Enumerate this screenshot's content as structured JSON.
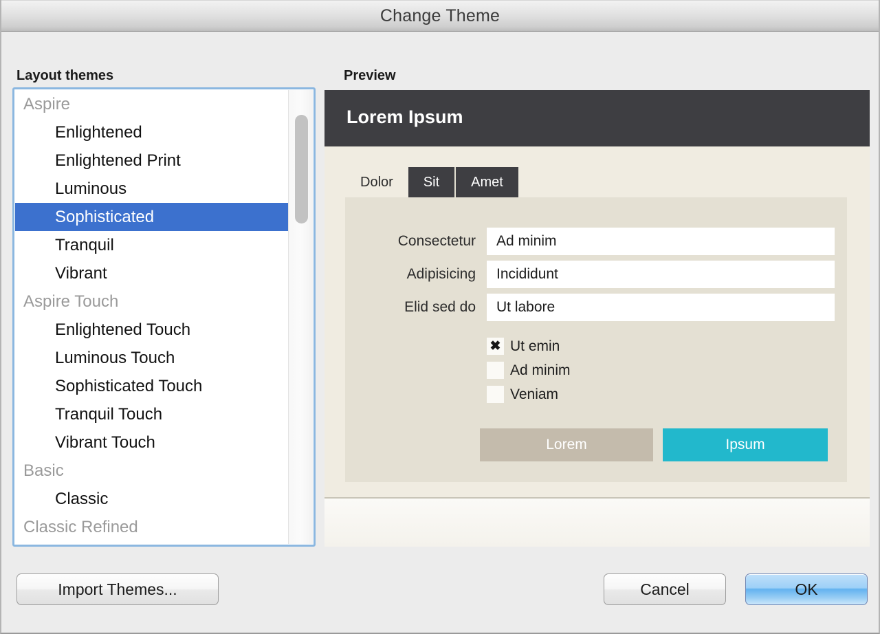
{
  "window": {
    "title": "Change Theme"
  },
  "left": {
    "heading": "Layout themes",
    "list": [
      {
        "label": "Aspire",
        "type": "group",
        "selected": false
      },
      {
        "label": "Enlightened",
        "type": "item",
        "selected": false
      },
      {
        "label": "Enlightened Print",
        "type": "item",
        "selected": false
      },
      {
        "label": "Luminous",
        "type": "item",
        "selected": false
      },
      {
        "label": "Sophisticated",
        "type": "item",
        "selected": true
      },
      {
        "label": "Tranquil",
        "type": "item",
        "selected": false
      },
      {
        "label": "Vibrant",
        "type": "item",
        "selected": false
      },
      {
        "label": "Aspire Touch",
        "type": "group",
        "selected": false
      },
      {
        "label": "Enlightened Touch",
        "type": "item",
        "selected": false
      },
      {
        "label": "Luminous Touch",
        "type": "item",
        "selected": false
      },
      {
        "label": "Sophisticated Touch",
        "type": "item",
        "selected": false
      },
      {
        "label": "Tranquil Touch",
        "type": "item",
        "selected": false
      },
      {
        "label": "Vibrant Touch",
        "type": "item",
        "selected": false
      },
      {
        "label": "Basic",
        "type": "group",
        "selected": false
      },
      {
        "label": "Classic",
        "type": "item",
        "selected": false
      },
      {
        "label": "Classic Refined",
        "type": "group",
        "selected": false
      }
    ]
  },
  "preview": {
    "heading": "Preview",
    "header_title": "Lorem Ipsum",
    "tabs": [
      {
        "label": "Dolor",
        "active": true
      },
      {
        "label": "Sit",
        "active": false
      },
      {
        "label": "Amet",
        "active": false
      }
    ],
    "fields": [
      {
        "label": "Consectetur",
        "value": "Ad minim",
        "kind": "text"
      },
      {
        "label": "Adipisicing",
        "value": "Incididunt",
        "kind": "text"
      },
      {
        "label": "Elid sed do",
        "value": "Ut labore",
        "kind": "dropdown"
      }
    ],
    "checkboxes": [
      {
        "label": "Ut emin",
        "checked": true,
        "glyph": "✖"
      },
      {
        "label": "Ad minim",
        "checked": false,
        "glyph": ""
      },
      {
        "label": "Veniam",
        "checked": false,
        "glyph": ""
      }
    ],
    "buttons": {
      "secondary": "Lorem",
      "primary": "Ipsum"
    },
    "colors": {
      "header_bg": "#3e3e42",
      "panel_bg": "#f0ece1",
      "form_bg": "#e4e0d3",
      "secondary_button": "#c4bbac",
      "primary_button": "#22b8cc"
    }
  },
  "footer": {
    "import_label": "Import Themes...",
    "cancel_label": "Cancel",
    "ok_label": "OK"
  },
  "theme": {
    "selection_blue": "#3c71ce",
    "focus_ring": "#8bb7e0",
    "dialog_bg": "#ececec"
  }
}
